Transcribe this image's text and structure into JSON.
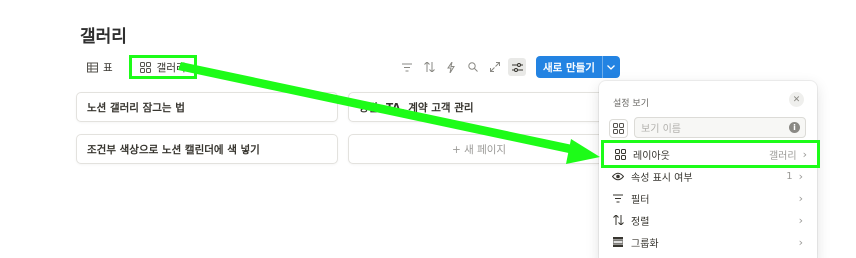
{
  "page": {
    "title": "갤러리"
  },
  "views": {
    "table_label": "표",
    "gallery_label": "갤러리"
  },
  "toolbar": {
    "new_button": "새로 만들기",
    "icons": [
      "filter-icon",
      "sort-icon",
      "automation-icon",
      "search-icon",
      "expand-icon",
      "settings-icon",
      "chevron-down-icon"
    ]
  },
  "cards": {
    "card1": "노션 갤러리 잠그는 법",
    "card2": "상담, TA, 계약 고객 관리",
    "card3": "조건부 색상으로 노션 캘린더에 색 넣기",
    "new_page": "+ 새 페이지"
  },
  "panel": {
    "title": "설정 보기",
    "name_placeholder": "보기 이름",
    "items": [
      {
        "label": "레이아웃",
        "value": "갤러리"
      },
      {
        "label": "속성 표시 여부",
        "value": "1"
      },
      {
        "label": "필터",
        "value": ""
      },
      {
        "label": "정렬",
        "value": ""
      },
      {
        "label": "그룹화",
        "value": ""
      }
    ]
  },
  "colors": {
    "accent": "#2383e2",
    "annotation": "#1dfc18",
    "text": "#37352f"
  }
}
